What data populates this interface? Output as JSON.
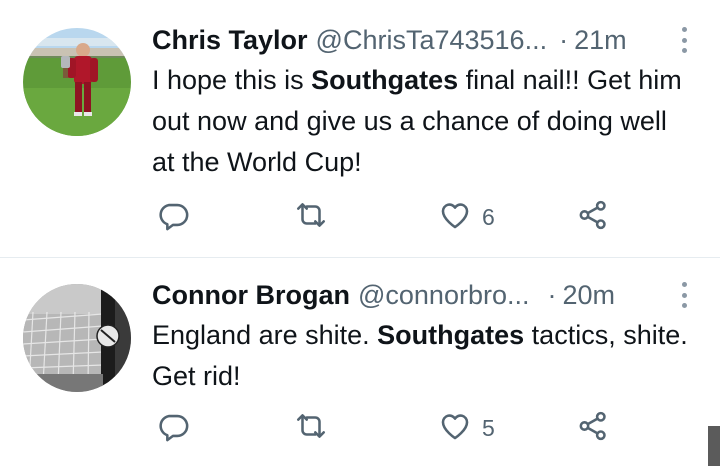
{
  "tweets": [
    {
      "display_name": "Chris Taylor",
      "handle": "@ChrisTa743516...",
      "separator": "·",
      "time": "21m",
      "text_segments": [
        {
          "text": "I hope this is ",
          "bold": false
        },
        {
          "text": "Southgates",
          "bold": true
        },
        {
          "text": " final nail!! Get him out now and give us a chance of doing well at the World Cup!",
          "bold": false
        }
      ],
      "reply_count": "",
      "retweet_count": "",
      "like_count": "6",
      "avatar": "photo-man-in-red-kit-holding-trophy-on-pitch"
    },
    {
      "display_name": "Connor Brogan",
      "handle": "@connorbro...",
      "separator": "·",
      "time": "20m",
      "text_segments": [
        {
          "text": "England are shite. ",
          "bold": false
        },
        {
          "text": "Southgates",
          "bold": true
        },
        {
          "text": " tactics, shite. Get rid!",
          "bold": false
        }
      ],
      "reply_count": "",
      "retweet_count": "",
      "like_count": "5",
      "avatar": "black-and-white-photo-goal-net-and-post"
    }
  ],
  "icons": {
    "reply": "reply-icon",
    "retweet": "retweet-icon",
    "like": "heart-icon",
    "share": "share-icon",
    "more": "more-vertical-icon"
  },
  "colors": {
    "text": "#0f1419",
    "secondary": "#536471",
    "divider": "#e6ecf0",
    "icon": "#536471"
  }
}
